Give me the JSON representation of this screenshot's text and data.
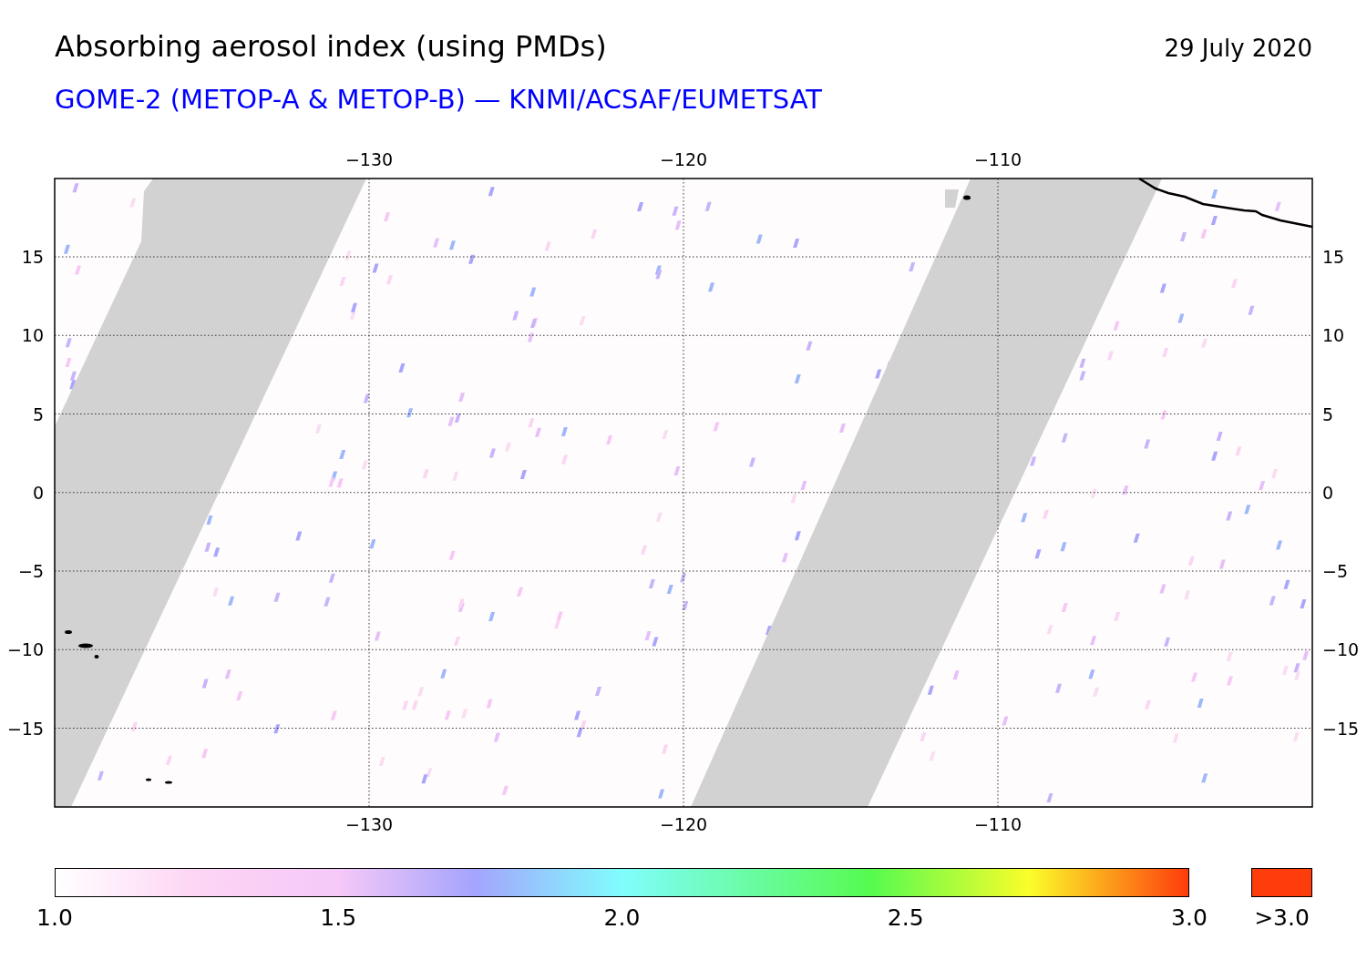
{
  "title": "Absorbing aerosol index (using PMDs)",
  "date": "29 July 2020",
  "subtitle": "GOME-2 (METOP-A & METOP-B) — KNMI/ACSAF/EUMETSAT",
  "map": {
    "top_ticks": [
      "−130",
      "−120",
      "−110"
    ],
    "bottom_ticks": [
      "−130",
      "−120",
      "−110"
    ],
    "left_ticks": [
      "15",
      "10",
      "5",
      "0",
      "−5",
      "−10",
      "−15"
    ],
    "right_ticks": [
      "15",
      "10",
      "5",
      "0",
      "−5",
      "−10",
      "−15"
    ]
  },
  "colorbar": {
    "ticks": [
      "1.0",
      "1.5",
      "2.0",
      "2.5",
      "3.0"
    ],
    "overflow_label": ">3.0"
  }
}
